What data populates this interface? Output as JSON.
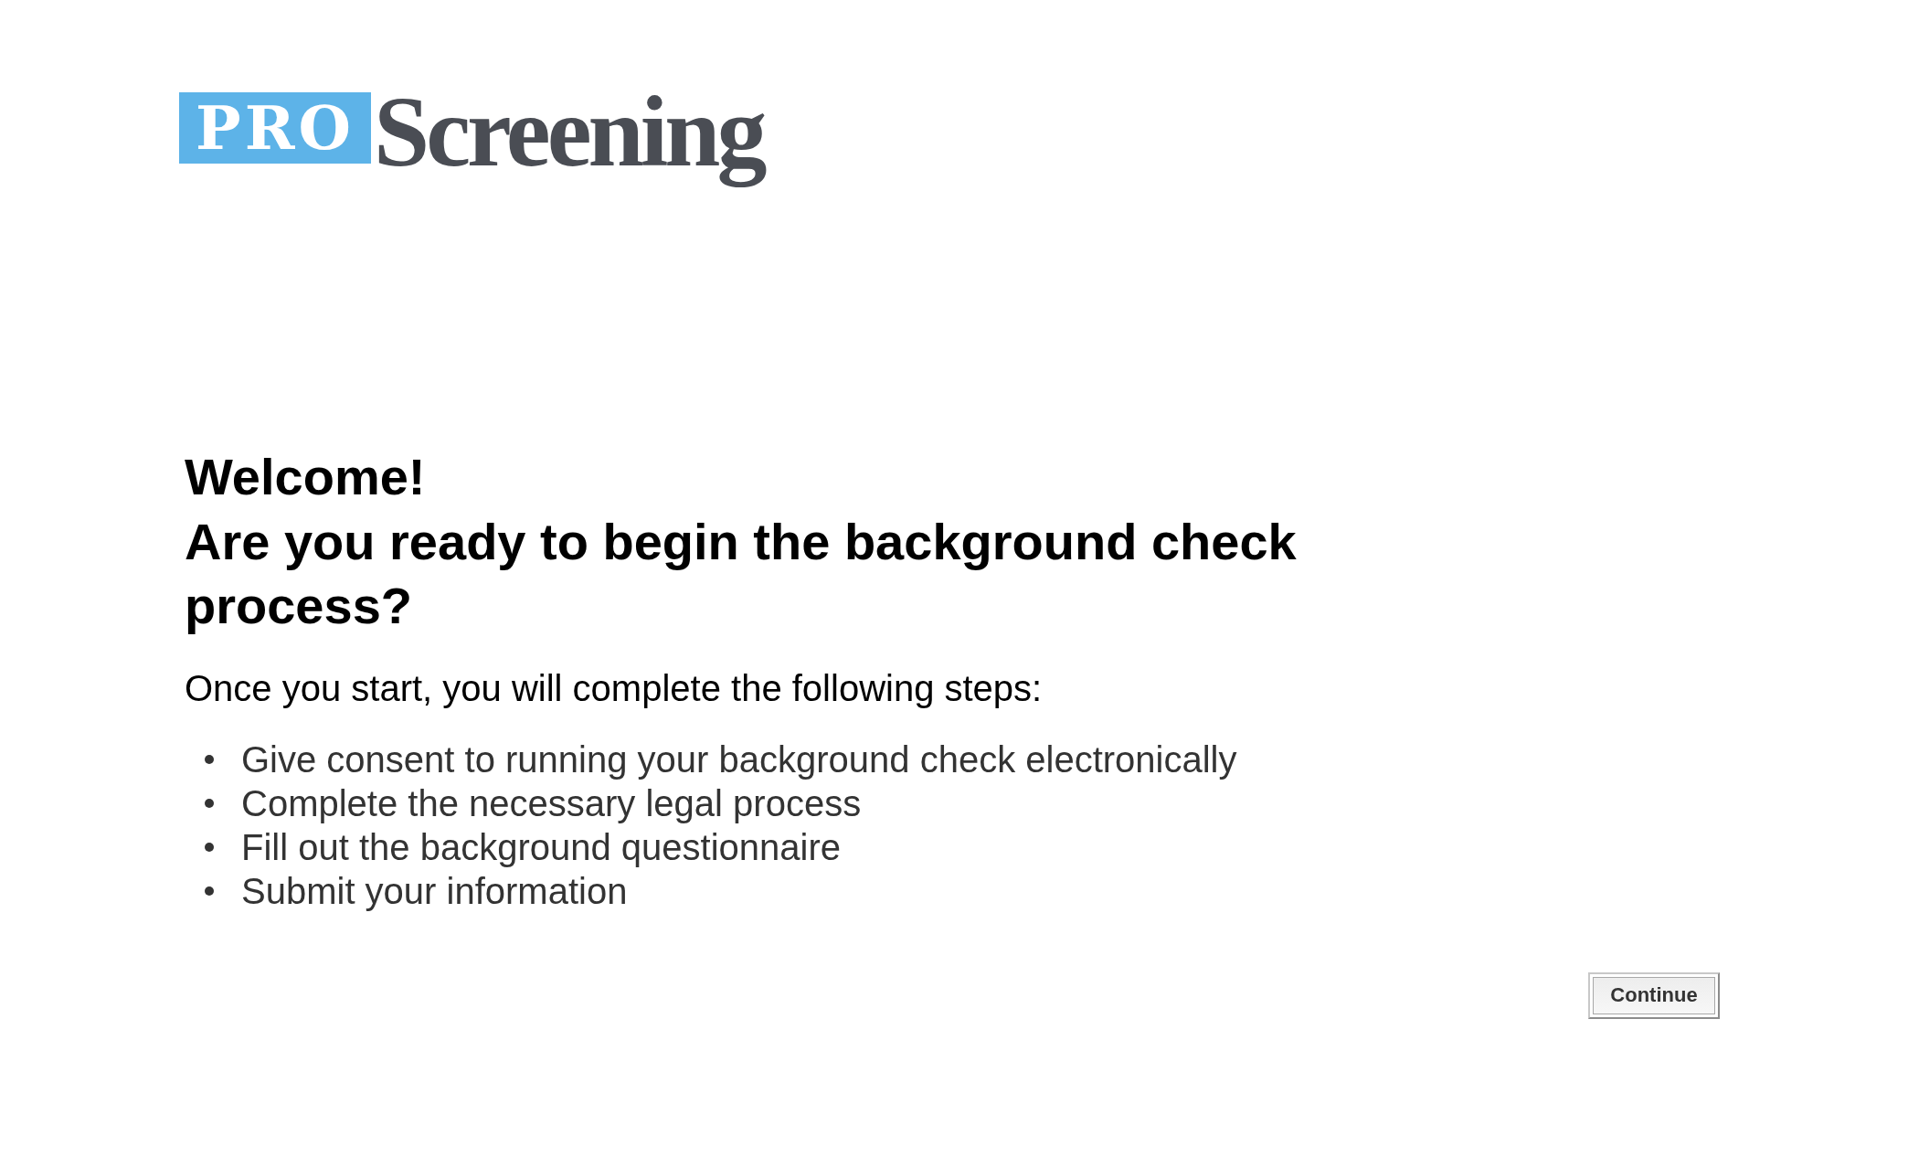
{
  "logo": {
    "badge": "PRO",
    "wordmark": "Screening"
  },
  "heading": {
    "greeting": "Welcome!",
    "question": "Are you ready to begin the background check process?"
  },
  "intro": "Once you start, you will complete the following steps:",
  "steps": [
    "Give consent to running your background check electronically",
    "Complete the necessary legal process",
    "Fill out the background questionnaire",
    "Submit your information"
  ],
  "buttons": [
    {
      "label": "Continue"
    }
  ]
}
